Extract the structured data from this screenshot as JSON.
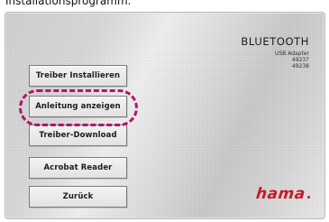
{
  "caption": "Installationsprogramm.",
  "panel": {
    "buttons": [
      {
        "label": "Treiber Installieren"
      },
      {
        "label": "Anleitung anzeigen"
      },
      {
        "label": "Treiber-Download"
      },
      {
        "label": "Acrobat Reader"
      },
      {
        "label": "Zurück"
      }
    ],
    "highlight": {
      "target": "Anleitung anzeigen",
      "color": "#b3156a"
    },
    "product": {
      "title": "BLUETOOTH",
      "line1": "USB Adapter",
      "line2": "49237",
      "line3": "49238"
    },
    "brand": {
      "logo_text": "hama",
      "logo_color": "#c61b2a"
    }
  }
}
